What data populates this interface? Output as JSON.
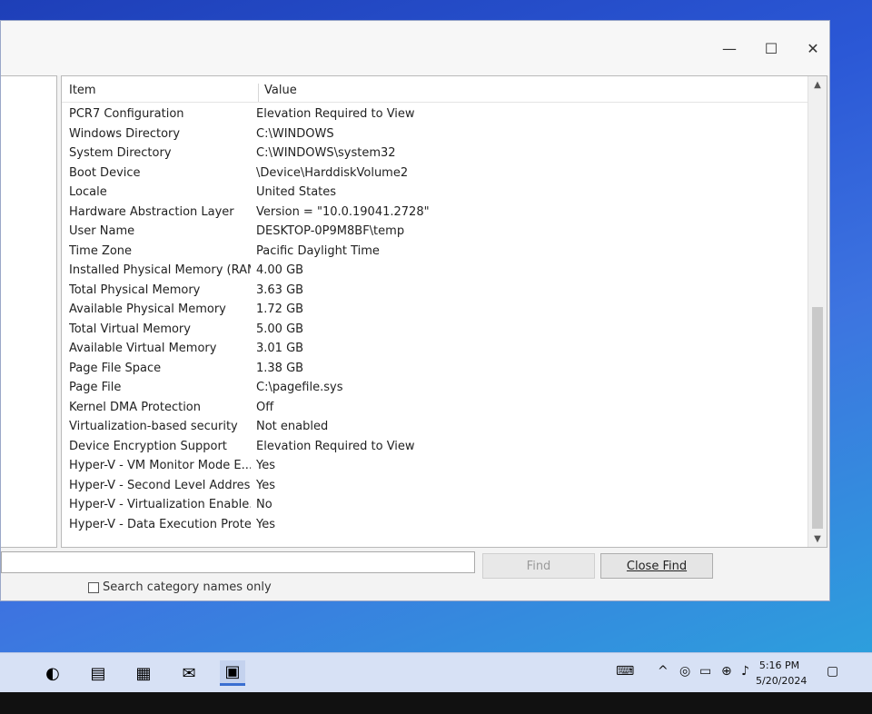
{
  "window": {
    "controls": {
      "minimize": "—",
      "maximize": "☐",
      "close": "✕"
    }
  },
  "list": {
    "headers": {
      "item": "Item",
      "value": "Value"
    },
    "rows": [
      {
        "item": "PCR7 Configuration",
        "value": "Elevation Required to View"
      },
      {
        "item": "Windows Directory",
        "value": "C:\\WINDOWS"
      },
      {
        "item": "System Directory",
        "value": "C:\\WINDOWS\\system32"
      },
      {
        "item": "Boot Device",
        "value": "\\Device\\HarddiskVolume2"
      },
      {
        "item": "Locale",
        "value": "United States"
      },
      {
        "item": "Hardware Abstraction Layer",
        "value": "Version = \"10.0.19041.2728\""
      },
      {
        "item": "User Name",
        "value": "DESKTOP-0P9M8BF\\temp"
      },
      {
        "item": "Time Zone",
        "value": "Pacific Daylight Time"
      },
      {
        "item": "Installed Physical Memory (RAM)",
        "value": "4.00 GB"
      },
      {
        "item": "Total Physical Memory",
        "value": "3.63 GB"
      },
      {
        "item": "Available Physical Memory",
        "value": "1.72 GB"
      },
      {
        "item": "Total Virtual Memory",
        "value": "5.00 GB"
      },
      {
        "item": "Available Virtual Memory",
        "value": "3.01 GB"
      },
      {
        "item": "Page File Space",
        "value": "1.38 GB"
      },
      {
        "item": "Page File",
        "value": "C:\\pagefile.sys"
      },
      {
        "item": "Kernel DMA Protection",
        "value": "Off"
      },
      {
        "item": "Virtualization-based security",
        "value": "Not enabled"
      },
      {
        "item": "Device Encryption Support",
        "value": "Elevation Required to View"
      },
      {
        "item": "Hyper-V - VM Monitor Mode E...",
        "value": "Yes"
      },
      {
        "item": "Hyper-V - Second Level Addres...",
        "value": "Yes"
      },
      {
        "item": "Hyper-V - Virtualization Enable...",
        "value": "No"
      },
      {
        "item": "Hyper-V - Data Execution Prote...",
        "value": "Yes"
      }
    ]
  },
  "find": {
    "find_label": "Find",
    "close_find_label": "Close Find",
    "search_category_label": "Search category names only",
    "input_value": ""
  },
  "taskbar": {
    "apps": [
      {
        "name": "edge-icon",
        "glyph": "◐"
      },
      {
        "name": "file-explorer-icon",
        "glyph": "▤"
      },
      {
        "name": "store-icon",
        "glyph": "▦"
      },
      {
        "name": "mail-icon",
        "glyph": "✉"
      },
      {
        "name": "system-information-icon",
        "glyph": "▣"
      }
    ],
    "time": "5:16 PM",
    "date": "5/20/2024"
  }
}
